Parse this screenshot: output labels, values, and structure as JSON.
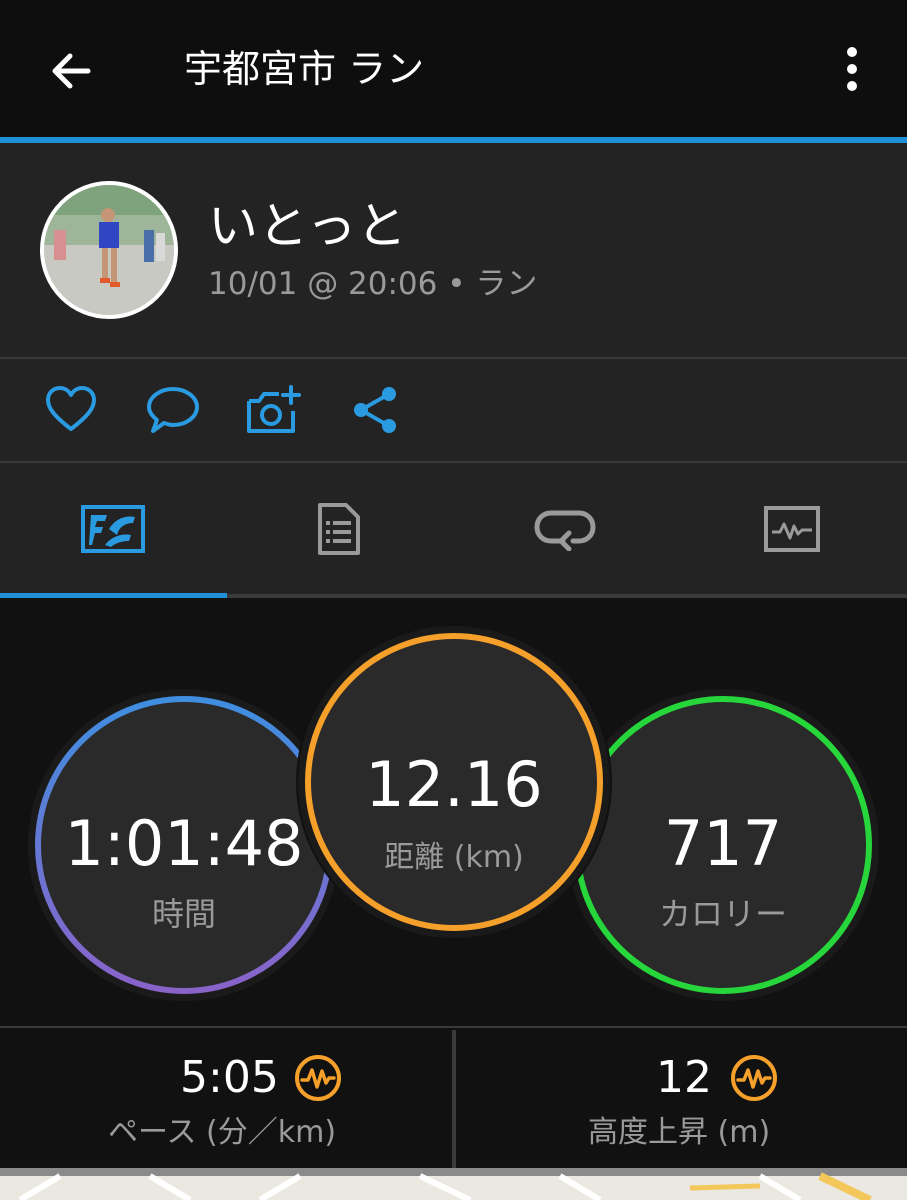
{
  "topbar": {
    "title": "宇都宮市 ラン",
    "back_icon": "arrow-left-icon",
    "more_icon": "more-vertical-icon"
  },
  "header": {
    "user_name": "いとっと",
    "meta": "10/01 @ 20:06 • ラン"
  },
  "actions": [
    {
      "icon": "heart-icon"
    },
    {
      "icon": "comment-icon"
    },
    {
      "icon": "add-photo-icon"
    },
    {
      "icon": "share-icon"
    }
  ],
  "tabs": [
    {
      "icon": "overview-icon",
      "active": true
    },
    {
      "icon": "details-list-icon",
      "active": false
    },
    {
      "icon": "laps-icon",
      "active": false
    },
    {
      "icon": "chart-icon",
      "active": false
    }
  ],
  "stats": {
    "time": {
      "value": "1:01:48",
      "label": "時間"
    },
    "distance": {
      "value": "12.16",
      "label": "距離 (km)"
    },
    "calories": {
      "value": "717",
      "label": "カロリー"
    }
  },
  "bottom_stats": {
    "pace": {
      "value": "5:05",
      "label": "ペース (分／km)"
    },
    "elevation": {
      "value": "12",
      "label": "高度上昇 (m)"
    }
  },
  "colors": {
    "accent": "#1f8fd8",
    "distance_ring": "#f5a02a",
    "calories_ring": "#26d63a",
    "time_ring_start": "#3f8ee0",
    "time_ring_end": "#8a63c9"
  }
}
